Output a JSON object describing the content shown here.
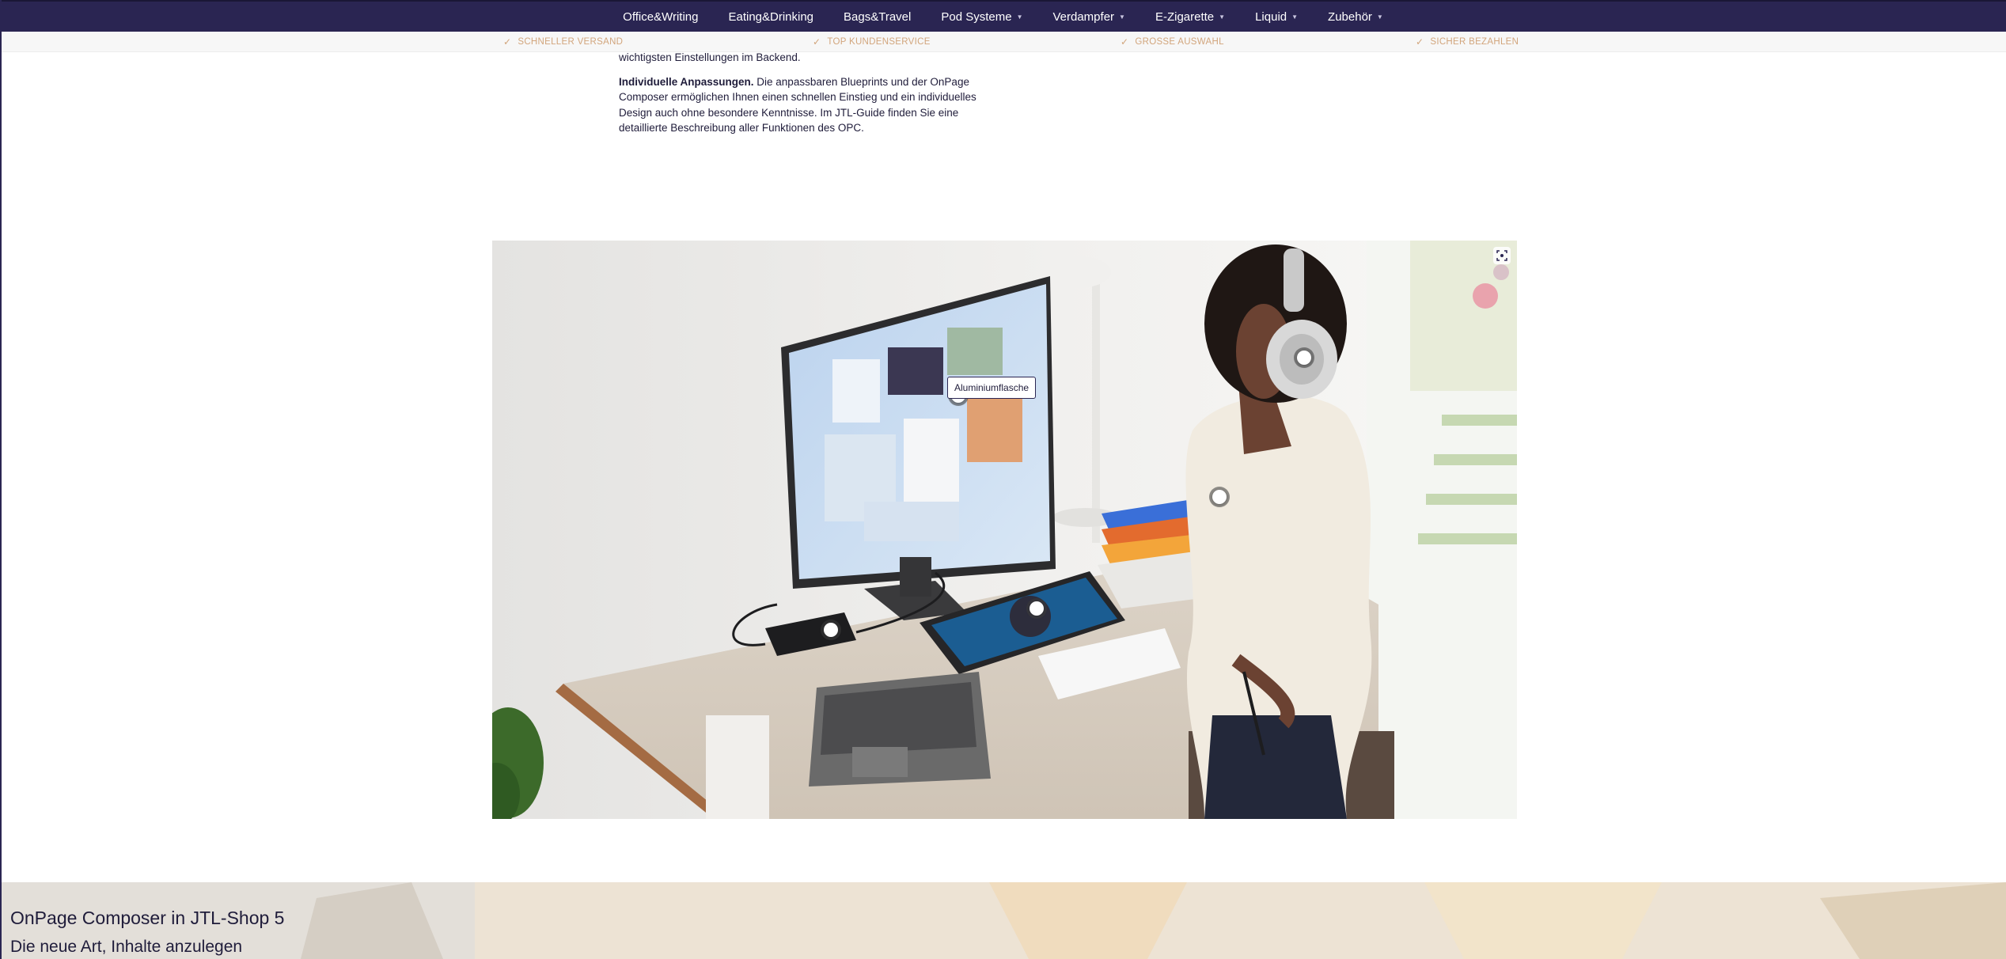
{
  "nav": {
    "items": [
      {
        "label": "Office&Writing",
        "has_dropdown": false
      },
      {
        "label": "Eating&Drinking",
        "has_dropdown": false
      },
      {
        "label": "Bags&Travel",
        "has_dropdown": false
      },
      {
        "label": "Pod Systeme",
        "has_dropdown": true
      },
      {
        "label": "Verdampfer",
        "has_dropdown": true
      },
      {
        "label": "E-Zigarette",
        "has_dropdown": true
      },
      {
        "label": "Liquid",
        "has_dropdown": true
      },
      {
        "label": "Zubehör",
        "has_dropdown": true
      }
    ],
    "caret": "▼"
  },
  "usp": {
    "items": [
      {
        "label": "SCHNELLER VERSAND"
      },
      {
        "label": "TOP KUNDENSERVICE"
      },
      {
        "label": "GROSSE AUSWAHL"
      },
      {
        "label": "SICHER BEZAHLEN"
      }
    ],
    "check": "✓"
  },
  "content": {
    "para1": "wichtigsten Einstellungen im Backend.",
    "para2_bold": "Individuelle Anpassungen.",
    "para2_text": " Die anpassbaren Blueprints und der OnPage Composer ermöglichen Ihnen einen schnellen Einstieg und ein individuelles Design auch ohne besondere Kenntnisse. Im JTL-Guide finden Sie eine detaillierte Beschreibung aller Funktionen des OPC."
  },
  "image": {
    "tooltip": "Aluminiumflasche"
  },
  "banner": {
    "title": "OnPage Composer in JTL-Shop 5",
    "subtitle": "Die neue Art, Inhalte anzulegen"
  },
  "colors": {
    "nav_bg": "#2a2552",
    "usp_text": "#d2a57c",
    "text": "#1f1c3a",
    "banner_bg": "#ece2d3"
  }
}
